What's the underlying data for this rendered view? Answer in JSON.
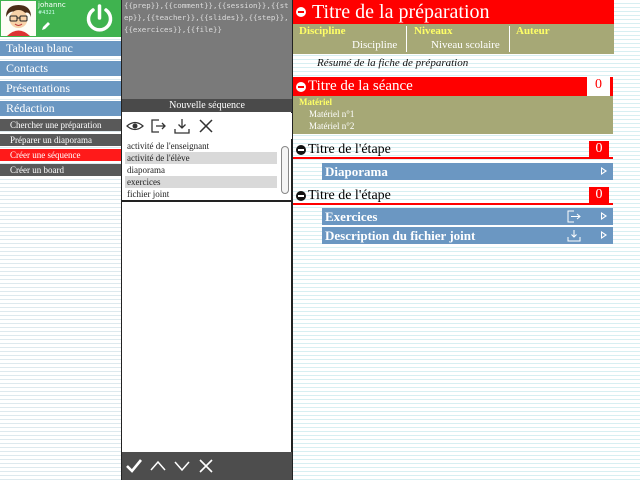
{
  "user": {
    "name": "johannc",
    "code": "#4321"
  },
  "menu": {
    "items": [
      {
        "label": "Tableau blanc"
      },
      {
        "label": "Contacts"
      },
      {
        "label": "Présentations"
      },
      {
        "label": "Rédaction"
      }
    ],
    "sub_items": [
      {
        "label": "Chercher une préparation",
        "active": false
      },
      {
        "label": "Préparer un diaporama",
        "active": false
      },
      {
        "label": "Créer une séquence",
        "active": true
      },
      {
        "label": "Créer un board",
        "active": false
      }
    ]
  },
  "middle": {
    "template_code": "{{prep}},{{comment}},{{session}},{{step}},{{teacher}},{{slides}},{{step}},{{exercices}},{{file}}",
    "section_label": "Nouvelle séquence",
    "toolbar_icons": [
      "eye-icon",
      "export-icon",
      "download-icon",
      "close-icon"
    ],
    "activities": [
      "activité de l'enseignant",
      "activité de l'élève",
      "diaporama",
      "exercices",
      "fichier joint"
    ],
    "bottom_icons": [
      "check-icon",
      "arrow-up-icon",
      "arrow-down-icon",
      "close-icon"
    ]
  },
  "preparation": {
    "title": "Titre de la préparation",
    "columns": [
      {
        "header": "Discipline",
        "value": "Discipline"
      },
      {
        "header": "Niveaux",
        "value": "Niveau scolaire"
      },
      {
        "header": "Auteur",
        "value": ""
      }
    ],
    "summary": "Résumé de la fiche de préparation"
  },
  "seance": {
    "title": "Titre de la séance",
    "count": "0",
    "materiel_label": "Matériel",
    "materiel_items": [
      "Matériel n°1",
      "Matériel n°2"
    ]
  },
  "etapes": [
    {
      "title": "Titre de l'étape",
      "count": "0",
      "bars": [
        {
          "label": "Diaporama"
        }
      ]
    },
    {
      "title": "Titre de l'étape",
      "count": "0",
      "bars": [
        {
          "label": "Exercices"
        },
        {
          "label": "Description du fichier joint"
        }
      ]
    }
  ],
  "colors": {
    "accent_red": "#ff0000",
    "menu_blue": "#6b97c2",
    "user_green": "#3fb34f",
    "olive": "#a6a876",
    "heading_yellow": "#ffff66"
  }
}
